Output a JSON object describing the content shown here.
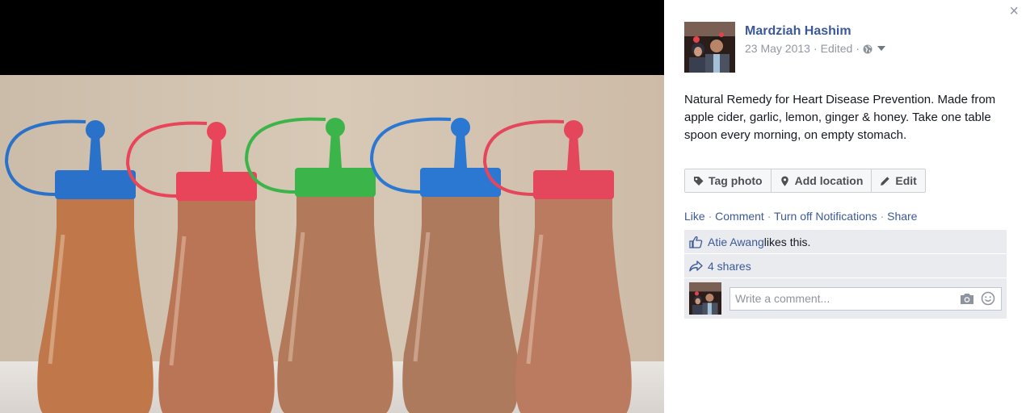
{
  "photo": {
    "bottles": [
      {
        "cap_color": "#2a72c9",
        "liquid_color": "#c0784b"
      },
      {
        "cap_color": "#e9455a",
        "liquid_color": "#b97556"
      },
      {
        "cap_color": "#3bb54a",
        "liquid_color": "#b27a5b"
      },
      {
        "cap_color": "#2a78d2",
        "liquid_color": "#ae7a5e"
      },
      {
        "cap_color": "#e4465c",
        "liquid_color": "#ba7b61"
      }
    ]
  },
  "post": {
    "author": "Mardziah Hashim",
    "date": "23 May 2013",
    "separator": "·",
    "edited": "Edited",
    "separator2": "·",
    "caption": "Natural Remedy for Heart Disease Prevention. Made from apple cider, garlic, lemon, ginger & honey. Take one table spoon every morning, on empty stomach."
  },
  "buttons": {
    "tag_photo": "Tag photo",
    "add_location": "Add location",
    "edit": "Edit"
  },
  "actions": {
    "like": "Like",
    "comment": "Comment",
    "turn_off": "Turn off Notifications",
    "share": "Share",
    "sep": " · "
  },
  "ufi": {
    "liker": "Atie Awang",
    "likes_suffix": " likes this.",
    "shares": "4 shares",
    "comment_placeholder": "Write a comment..."
  },
  "colors": {
    "link": "#3b5998",
    "meta": "#9197a3",
    "ufi_bg": "#e9ebee"
  },
  "icons": {
    "close": "close-icon",
    "globe": "globe-icon",
    "tag": "tag-icon",
    "location": "location-pin-icon",
    "edit": "pencil-icon",
    "like": "thumbs-up-icon",
    "share": "share-arrow-icon",
    "camera": "camera-icon",
    "emoji": "smiley-icon"
  }
}
